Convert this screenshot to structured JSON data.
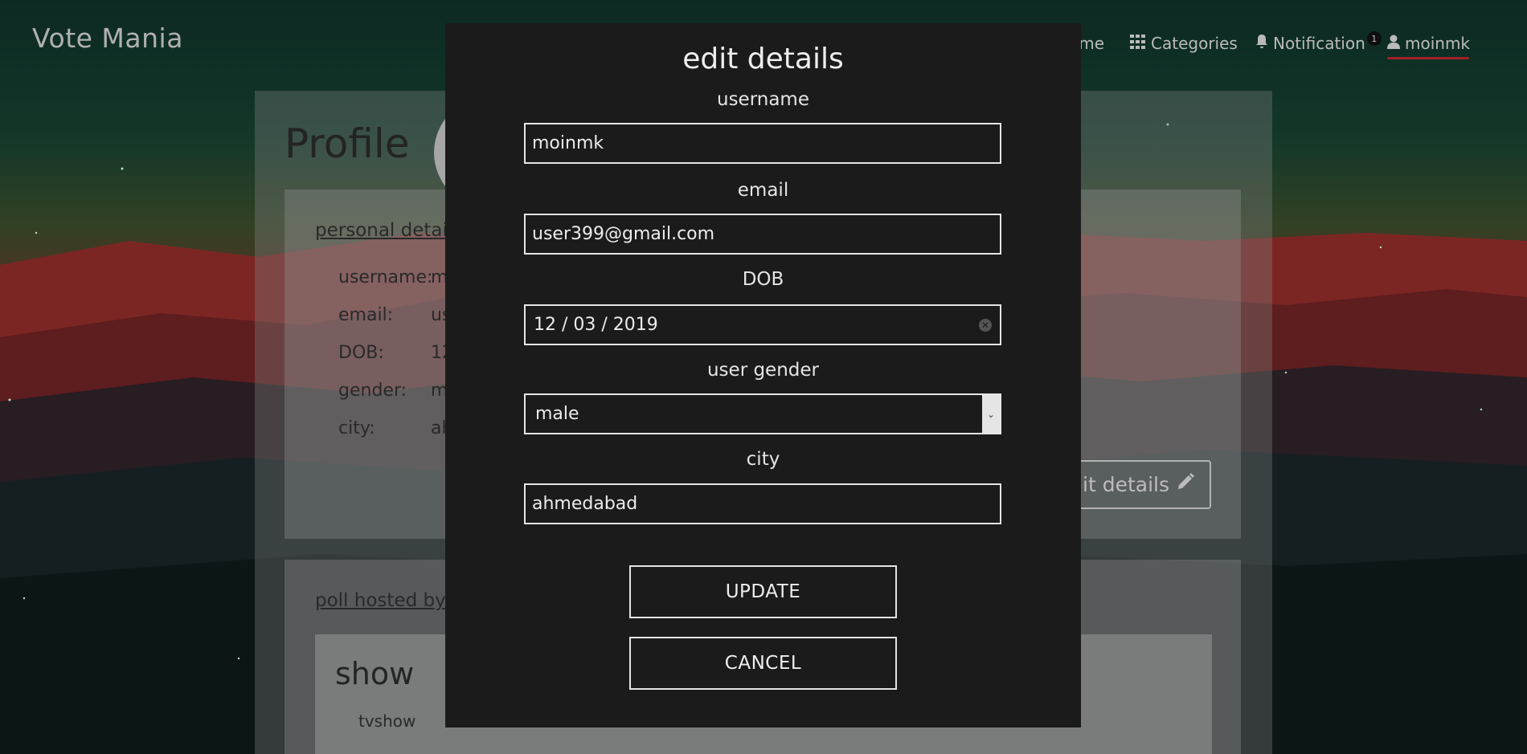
{
  "brand": "Vote Mania",
  "nav": {
    "home_label": "ome",
    "categories_label": "Categories",
    "notification_label": "Notification",
    "notification_count": "1",
    "user_label": "moinmk"
  },
  "profile": {
    "title": "Profile",
    "personal_heading": "personal detai",
    "rows": [
      {
        "key": "username:",
        "value": "m"
      },
      {
        "key": "email:",
        "value": "us"
      },
      {
        "key": "DOB:",
        "value": "12"
      },
      {
        "key": "gender:",
        "value": "m"
      },
      {
        "key": "city:",
        "value": "ah"
      }
    ],
    "edit_button_label": "dit details",
    "polls_heading": "poll hosted by",
    "show_title": "show",
    "show_sub": "tvshow"
  },
  "modal": {
    "title": "edit details",
    "username_label": "username",
    "username_value": "moinmk",
    "email_label": "email",
    "email_value": "user399@gmail.com",
    "dob_label": "DOB",
    "dob_value": "12 / 03 / 2019",
    "gender_label": "user gender",
    "gender_value": "male",
    "city_label": "city",
    "city_value": "ahmedabad",
    "update_label": "UPDATE",
    "cancel_label": "CANCEL"
  },
  "colors": {
    "accent_underline": "#b3262b",
    "modal_bg": "#1b1b1b"
  }
}
